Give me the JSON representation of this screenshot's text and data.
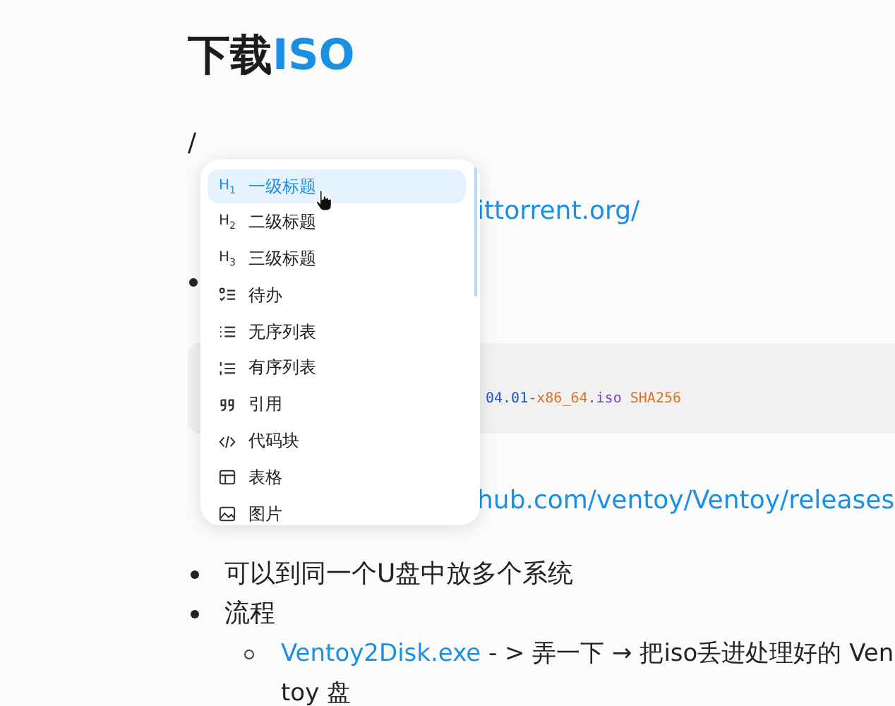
{
  "document": {
    "title": [
      {
        "text": "下载",
        "kind": "plain"
      },
      {
        "text": "ISO",
        "kind": "accent"
      }
    ],
    "blocks": [
      {
        "kind": "line",
        "text": "/"
      },
      {
        "kind": "line",
        "link": "ittorrent.org/"
      },
      {
        "kind": "bullet"
      },
      {
        "kind": "code",
        "tokens": [
          {
            "text": "04.01",
            "kind": "number"
          },
          {
            "text": "-",
            "kind": "punct"
          },
          {
            "text": "x86_64",
            "kind": "string"
          },
          {
            "text": ".iso",
            "kind": "keyword"
          },
          {
            "text": " SHA256",
            "kind": "string"
          }
        ]
      },
      {
        "kind": "line",
        "link": "hub.com/ventoy/Ventoy/releases"
      },
      {
        "kind": "list",
        "items": [
          {
            "text": "可以到同一个U盘中放多个系统"
          },
          {
            "text": "流程",
            "children": [
              {
                "link": "Ventoy2Disk.exe",
                "text": " - > 弄一下 → 把iso丢进处理好的 Ventoy 盘"
              }
            ]
          }
        ]
      }
    ]
  },
  "menu": {
    "items": [
      {
        "kind": "heading",
        "badge": "H$_{1}$",
        "label": "一级标题",
        "selected": true
      },
      {
        "kind": "heading",
        "badge": "H$_{2}$",
        "label": "二级标题",
        "selected": false
      },
      {
        "kind": "heading",
        "badge": "H$_{3}$",
        "label": "三级标题",
        "selected": false
      },
      {
        "kind": "todo",
        "label": "待办",
        "selected": false
      },
      {
        "kind": "bullet",
        "label": "无序列表",
        "selected": false
      },
      {
        "kind": "ordered",
        "label": "有序列表",
        "selected": false
      },
      {
        "kind": "quote",
        "label": "引用",
        "selected": false
      },
      {
        "kind": "code",
        "label": "代码块",
        "selected": false
      },
      {
        "kind": "table",
        "label": "表格",
        "selected": false
      },
      {
        "kind": "image",
        "label": "图片",
        "selected": false
      }
    ]
  }
}
